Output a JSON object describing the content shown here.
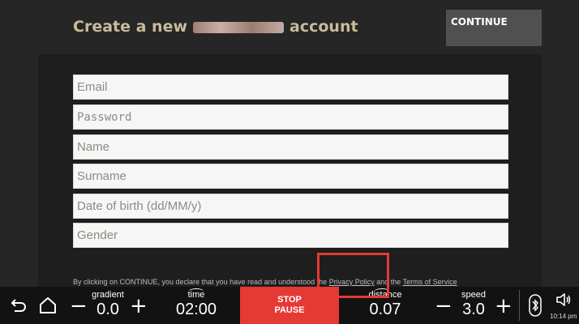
{
  "header": {
    "title_prefix": "Create a new",
    "title_suffix": "account",
    "continue_label": "CONTINUE"
  },
  "form": {
    "email_placeholder": "Email",
    "password_placeholder": "Password",
    "name_placeholder": "Name",
    "surname_placeholder": "Surname",
    "dob_placeholder": "Date of birth (dd/MM/y)",
    "gender_placeholder": "Gender"
  },
  "disclaimer": {
    "text_before": "By clicking on CONTINUE, you declare that you have read and understood the ",
    "privacy_link": "Privacy Policy",
    "text_middle": " and the ",
    "terms_link": "Terms of Service"
  },
  "bottom_bar": {
    "gradient": {
      "label": "gradient",
      "value": "0.0"
    },
    "time": {
      "label": "time",
      "value": "02:00"
    },
    "stop_label": "STOP",
    "pause_label": "PAUSE",
    "distance": {
      "label": "distance",
      "value": "0.07"
    },
    "speed": {
      "label": "speed",
      "value": "3.0"
    },
    "clock": "10:14 pm"
  },
  "colors": {
    "accent_red": "#e53935",
    "title": "#c9bb9b",
    "background": "#262626"
  }
}
